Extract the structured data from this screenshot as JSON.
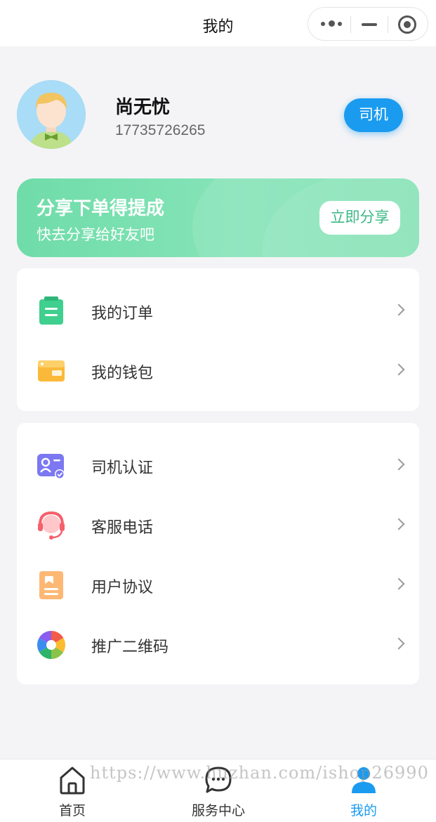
{
  "navbar": {
    "title": "我的"
  },
  "profile": {
    "name": "尚无忧",
    "phone": "17735726265",
    "role_badge": "司机"
  },
  "banner": {
    "title": "分享下单得提成",
    "subtitle": "快去分享给好友吧",
    "share_button": "立即分享"
  },
  "menu_group_1": [
    {
      "label": "我的订单",
      "icon": "clipboard-icon"
    },
    {
      "label": "我的钱包",
      "icon": "wallet-icon"
    }
  ],
  "menu_group_2": [
    {
      "label": "司机认证",
      "icon": "id-card-icon"
    },
    {
      "label": "客服电话",
      "icon": "headset-icon"
    },
    {
      "label": "用户协议",
      "icon": "document-icon"
    },
    {
      "label": "推广二维码",
      "icon": "aperture-icon"
    }
  ],
  "tabbar": [
    {
      "label": "首页",
      "icon": "home-icon"
    },
    {
      "label": "服务中心",
      "icon": "chat-bubble-icon"
    },
    {
      "label": "我的",
      "icon": "user-icon"
    }
  ],
  "active_tab": "我的",
  "watermark": "https://www.huzhan.com/ishop26990",
  "colors": {
    "accent": "#1a9bf0",
    "banner": "#7de0b1",
    "background": "#f4f4f6"
  }
}
